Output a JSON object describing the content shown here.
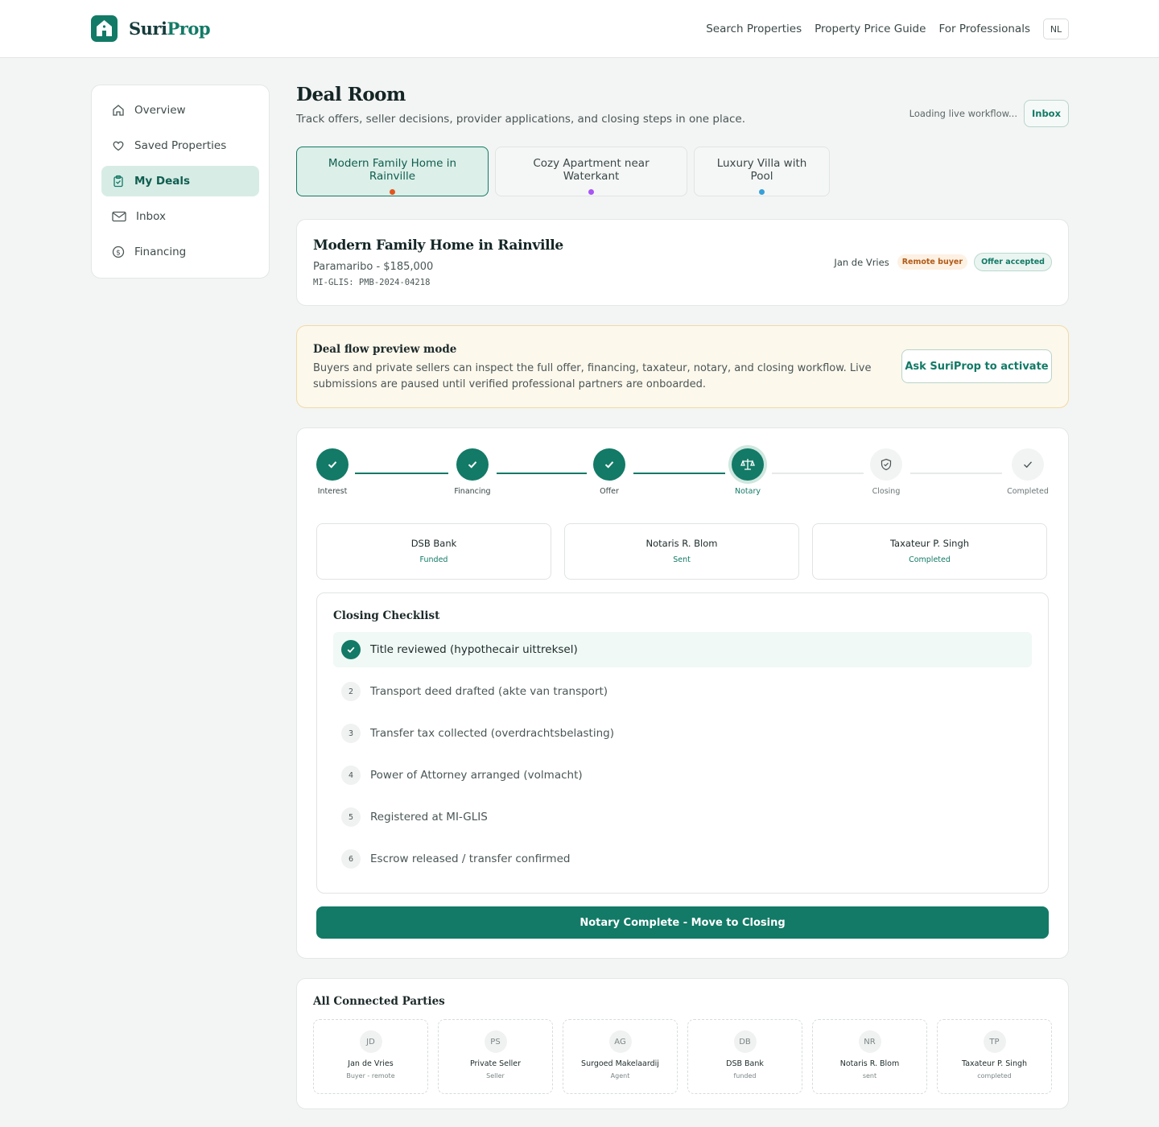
{
  "brand": {
    "name_a": "Suri",
    "name_b": "Prop"
  },
  "nav": {
    "items": [
      "Search Properties",
      "Property Price Guide",
      "For Professionals"
    ],
    "lang": "NL"
  },
  "sidebar": {
    "items": [
      {
        "label": "Overview",
        "icon": "home-icon"
      },
      {
        "label": "Saved Properties",
        "icon": "heart-icon"
      },
      {
        "label": "My Deals",
        "icon": "clipboard-check-icon",
        "active": true
      },
      {
        "label": "Inbox",
        "icon": "mail-icon"
      },
      {
        "label": "Financing",
        "icon": "dollar-circle-icon"
      }
    ]
  },
  "header": {
    "title": "Deal Room",
    "subtitle": "Track offers, seller decisions, provider applications, and closing steps in one place.",
    "loading": "Loading live workflow...",
    "inbox_label": "Inbox"
  },
  "tabs": [
    {
      "label": "Modern Family Home in Rainville",
      "dot_color": "#e2561e"
    },
    {
      "label": "Cozy Apartment near Waterkant",
      "dot_color": "#a855f7"
    },
    {
      "label": "Luxury Villa with Pool",
      "dot_color": "#38a0d8"
    }
  ],
  "property": {
    "title": "Modern Family Home in Rainville",
    "location_price": "Paramaribo - $185,000",
    "id": "MI-GLIS: PMB-2024-04218",
    "owner": "Jan de Vries",
    "badge_remote": "Remote buyer",
    "badge_status": "Offer accepted"
  },
  "preview": {
    "title": "Deal flow preview mode",
    "text": "Buyers and private sellers can inspect the full offer, financing, taxateur, notary, and closing workflow. Live submissions are paused until verified professional partners are onboarded.",
    "button": "Ask SuriProp to activate"
  },
  "steps": [
    {
      "label": "Interest",
      "state": "done"
    },
    {
      "label": "Financing",
      "state": "done"
    },
    {
      "label": "Offer",
      "state": "done"
    },
    {
      "label": "Notary",
      "state": "current"
    },
    {
      "label": "Closing",
      "state": "pending"
    },
    {
      "label": "Completed",
      "state": "pending"
    }
  ],
  "providers": [
    {
      "name": "DSB Bank",
      "status": "Funded"
    },
    {
      "name": "Notaris R. Blom",
      "status": "Sent"
    },
    {
      "name": "Taxateur P. Singh",
      "status": "Completed"
    }
  ],
  "checklist": {
    "title": "Closing Checklist",
    "items": [
      {
        "num": "1",
        "label": "Title reviewed (hypothecair uittreksel)",
        "done": true
      },
      {
        "num": "2",
        "label": "Transport deed drafted (akte van transport)",
        "done": false
      },
      {
        "num": "3",
        "label": "Transfer tax collected (overdrachtsbelasting)",
        "done": false
      },
      {
        "num": "4",
        "label": "Power of Attorney arranged (volmacht)",
        "done": false
      },
      {
        "num": "5",
        "label": "Registered at MI-GLIS",
        "done": false
      },
      {
        "num": "6",
        "label": "Escrow released / transfer confirmed",
        "done": false
      }
    ]
  },
  "cta": "Notary Complete - Move to Closing",
  "parties": {
    "title": "All Connected Parties",
    "items": [
      {
        "initials": "JD",
        "name": "Jan de Vries",
        "role": "Buyer - remote"
      },
      {
        "initials": "PS",
        "name": "Private Seller",
        "role": "Seller"
      },
      {
        "initials": "AG",
        "name": "Surgoed Makelaardij",
        "role": "Agent"
      },
      {
        "initials": "DB",
        "name": "DSB Bank",
        "role": "funded"
      },
      {
        "initials": "NR",
        "name": "Notaris R. Blom",
        "role": "sent"
      },
      {
        "initials": "TP",
        "name": "Taxateur P. Singh",
        "role": "completed"
      }
    ]
  },
  "colors": {
    "accent": "#127a66",
    "accent_light": "#d8ece6",
    "warning_bg": "#fdf8ec"
  }
}
